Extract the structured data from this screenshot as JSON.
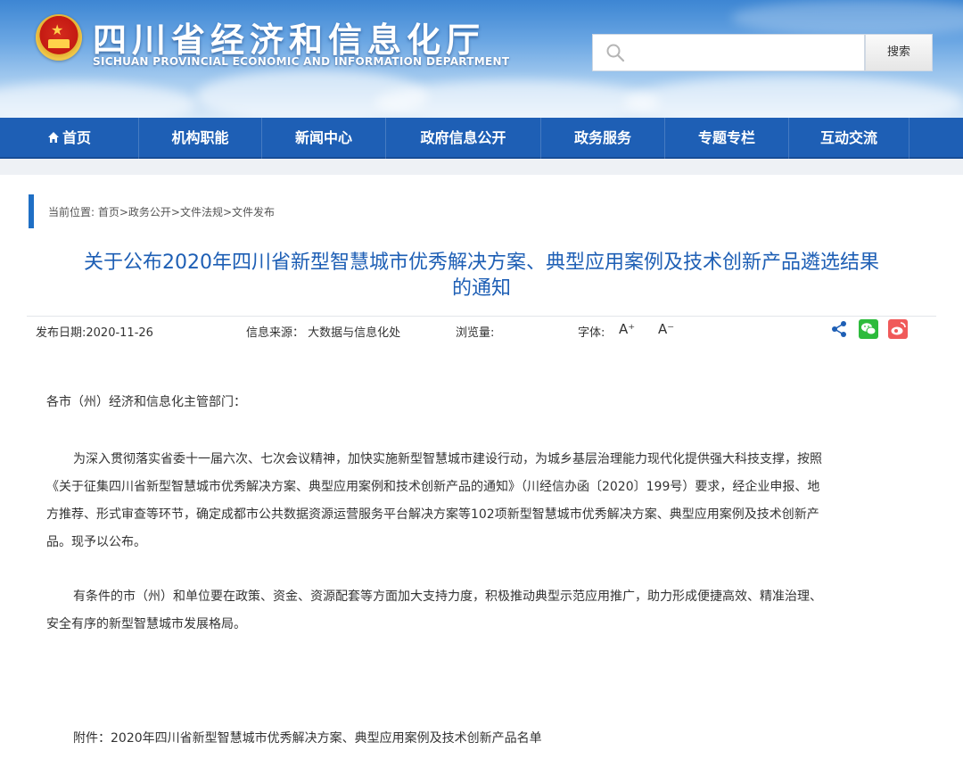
{
  "header": {
    "title": "四川省经济和信息化厅",
    "subtitle": "SICHUAN PROVINCIAL ECONOMIC AND INFORMATION DEPARTMENT",
    "search_placeholder": "",
    "search_button": "搜索"
  },
  "nav": {
    "items": [
      {
        "label": "首页",
        "icon": "home-icon"
      },
      {
        "label": "机构职能"
      },
      {
        "label": "新闻中心"
      },
      {
        "label": "政府信息公开"
      },
      {
        "label": "政务服务"
      },
      {
        "label": "专题专栏"
      },
      {
        "label": "互动交流"
      }
    ]
  },
  "breadcrumb": "当前位置: 首页>政务公开>文件法规>文件发布",
  "article": {
    "title_line1": "关于公布2020年四川省新型智慧城市优秀解决方案、典型应用案例及技术创新产品遴选结果",
    "title_line2": "的通知",
    "publish_date": "发布日期:2020-11-26",
    "source": "信息来源：  大数据与信息化处",
    "views": "浏览量:",
    "font_label": "字体:",
    "font_increase": "A⁺",
    "font_decrease": "A⁻",
    "salutation": "各市（州）经济和信息化主管部门：",
    "para1_line1": "为深入贯彻落实省委十一届六次、七次会议精神，加快实施新型智慧城市建设行动，为城乡基层治理能力现代化提供强大科技支撑，按照",
    "para1_line2": "《关于征集四川省新型智慧城市优秀解决方案、典型应用案例和技术创新产品的通知》（川经信办函〔2020〕199号）要求，经企业申报、地",
    "para1_line3": "方推荐、形式审查等环节，确定成都市公共数据资源运营服务平台解决方案等102项新型智慧城市优秀解决方案、典型应用案例及技术创新产",
    "para1_line4": "品。现予以公布。",
    "para2_line1": "有条件的市（州）和单位要在政策、资金、资源配套等方面加大支持力度，积极推动典型示范应用推广，助力形成便捷高效、精准治理、",
    "para2_line2": "安全有序的新型智慧城市发展格局。",
    "attachment": "附件：2020年四川省新型智慧城市优秀解决方案、典型应用案例及技术创新产品名单"
  },
  "colors": {
    "nav_bg": "#1e5fb5",
    "title_blue": "#1e5fb5",
    "accent_bar": "#1f6fc5",
    "wechat": "#2dbb3c",
    "weibo": "#f05a5a"
  }
}
